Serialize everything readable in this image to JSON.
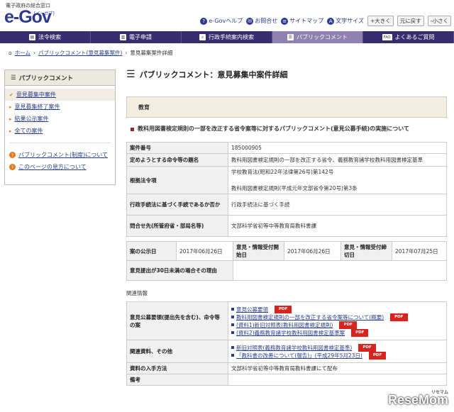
{
  "header": {
    "tagline": "電子政府の総合窓口",
    "logo": "e-Gov",
    "logo_sub": "[イーガブ]",
    "utils": [
      "e-Govヘルプ",
      "お問合せ",
      "サイトマップ",
      "文字サイズ"
    ],
    "size_buttons": [
      "+大きく",
      "元に戻す",
      "-小さく"
    ]
  },
  "nav": [
    "法令検索",
    "電子申請",
    "行政手続案内検索",
    "パブリックコメント",
    "よくあるご質問"
  ],
  "nav_icons": [
    "FAQ"
  ],
  "breadcrumb": [
    "ホーム",
    "パブリックコメント(意見募集案件)",
    "意見募集案件詳細"
  ],
  "sidebar": {
    "title": "パブリックコメント",
    "items": [
      "意見募集中案件",
      "意見募集終了案件",
      "結果公示案件",
      "全ての案件"
    ],
    "help": [
      "パブリックコメント(制度)について",
      "このページの見方について"
    ]
  },
  "main": {
    "title": "パブリックコメント：意見募集中案件詳細",
    "category": "教育",
    "case_title": "教科用図書検定規則の一部を改正する省令案等に対するパブリックコメント(意見公募手続)の実施について",
    "rows": [
      {
        "k": "案件番号",
        "v": "185000905"
      },
      {
        "k": "定めようとする命令等の題名",
        "v": "教科用図書検定規則の一部を改正する省令、義務教育諸学校教科用図書検定基準"
      },
      {
        "k": "根拠法令項",
        "v": "学校教育法(昭和22年法律第26号)第142号",
        "v2": "教科用図書検定規則(平成元年文部省令第20号)第3条"
      },
      {
        "k": "行政手続法に基づく手続であるか否か",
        "v": "行政手続法に基づく手続"
      },
      {
        "k": "問合せ先(所管府省・部局名等)",
        "v": "文部科学省初等中等教育局教科書課"
      }
    ],
    "dates": {
      "k1": "案の公示日",
      "v1": "2017年06月26日",
      "k2": "意見・情報受付開始日",
      "v2": "2017年06月26日",
      "k3": "意見・情報受付締切日",
      "v3": "2017年07月25日"
    },
    "short_period": "意見提出が30日未満の場合その理由",
    "related": "関連情報",
    "docs1_label": "意見公募要領(提出先を含む)、命令等の案",
    "docs1": [
      "意見公募要領",
      "教科用図書検定規則の一部を改正する省令案等について(概要)",
      "(資料1)新旧対照表(教科用図書検定規則)",
      "(資料2)義務教育諸学校教科用図書検定基準案"
    ],
    "docs2_label": "関連資料、その他",
    "docs2": [
      "新旧対照表(義務教育諸学校教科用図書検定基準)",
      "「教科書の改善について(報告)」(平成29年5月23日)"
    ],
    "pdf": "PDF",
    "obtain_k": "資料の入手方法",
    "obtain_v": "文部科学省初等中等教育局教科書課にて配布",
    "remarks": "備考"
  },
  "watermark": "ReseMom",
  "watermark_sub": "リセマム"
}
